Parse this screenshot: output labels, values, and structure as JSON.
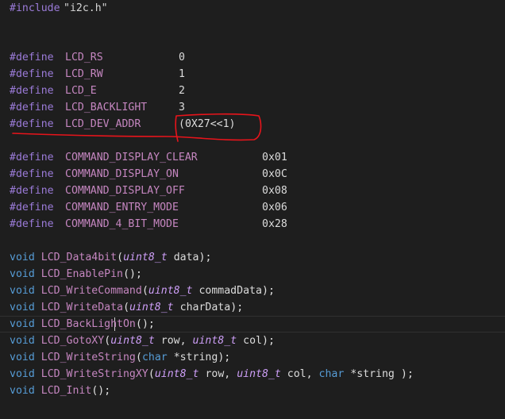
{
  "editor": {
    "include": {
      "directive": "#include",
      "file": "\"i2c.h\""
    },
    "defines_lcd": [
      {
        "directive": "#define",
        "name": "LCD_RS",
        "value": "0"
      },
      {
        "directive": "#define",
        "name": "LCD_RW",
        "value": "1"
      },
      {
        "directive": "#define",
        "name": "LCD_E",
        "value": "2"
      },
      {
        "directive": "#define",
        "name": "LCD_BACKLIGHT",
        "value": "3"
      },
      {
        "directive": "#define",
        "name": "LCD_DEV_ADDR",
        "value": "(0X27<<1)"
      }
    ],
    "defines_cmd": [
      {
        "directive": "#define",
        "name": "COMMAND_DISPLAY_CLEAR",
        "value": "0x01"
      },
      {
        "directive": "#define",
        "name": "COMMAND_DISPLAY_ON",
        "value": "0x0C"
      },
      {
        "directive": "#define",
        "name": "COMMAND_DISPLAY_OFF",
        "value": "0x08"
      },
      {
        "directive": "#define",
        "name": "COMMAND_ENTRY_MODE",
        "value": "0x06"
      },
      {
        "directive": "#define",
        "name": "COMMAND_4_BIT_MODE",
        "value": "0x28"
      }
    ],
    "prototypes": [
      {
        "ret": "void",
        "name": "LCD_Data4bit",
        "open": "(",
        "params": [
          {
            "type": "uint8_t",
            "rest": " data"
          }
        ],
        "close": ");"
      },
      {
        "ret": "void",
        "name": "LCD_EnablePin",
        "open": "(",
        "params": [],
        "close": ");"
      },
      {
        "ret": "void",
        "name": "LCD_WriteCommand",
        "open": "(",
        "params": [
          {
            "type": "uint8_t",
            "rest": " commadData"
          }
        ],
        "close": ");"
      },
      {
        "ret": "void",
        "name": "LCD_WriteData",
        "open": "(",
        "params": [
          {
            "type": "uint8_t",
            "rest": " charData"
          }
        ],
        "close": ");"
      },
      {
        "ret": "void",
        "name": "LCD_BackLightOn",
        "open": "(",
        "params": [],
        "close": ");"
      },
      {
        "ret": "void",
        "name": "LCD_GotoXY",
        "open": "(",
        "params": [
          {
            "type": "uint8_t",
            "rest": " row, "
          },
          {
            "type": "uint8_t",
            "rest": " col"
          }
        ],
        "close": ");"
      },
      {
        "ret": "void",
        "name": "LCD_WriteString",
        "open": "(",
        "params": [
          {
            "type": "char",
            "rest": " *string"
          }
        ],
        "close": ");"
      },
      {
        "ret": "void",
        "name": "LCD_WriteStringXY",
        "open": "(",
        "params": [
          {
            "type": "uint8_t",
            "rest": " row, "
          },
          {
            "type": "uint8_t",
            "rest": " col, "
          },
          {
            "type": "char",
            "rest": " *string "
          }
        ],
        "close": ");"
      },
      {
        "ret": "void",
        "name": "LCD_Init",
        "open": "(",
        "params": [],
        "close": ");"
      }
    ]
  },
  "colors": {
    "background": "#1e1e1e",
    "preprocessor": "#9b7bd8",
    "macro": "#c586c0",
    "keyword": "#569cd6",
    "annotation": "#e8141b"
  }
}
